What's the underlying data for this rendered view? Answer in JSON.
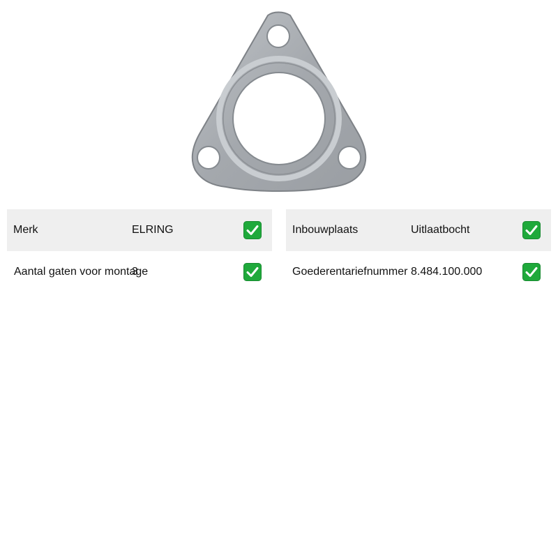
{
  "product": {
    "image_name": "exhaust-gasket-image"
  },
  "specs": {
    "left": [
      {
        "label": "Merk",
        "value": "ELRING",
        "icon": "check-icon"
      },
      {
        "label": "Aantal gaten voor montage",
        "value": "3",
        "icon": "check-icon"
      }
    ],
    "right": [
      {
        "label": "Inbouwplaats",
        "value": "Uitlaatbocht",
        "icon": "check-icon"
      },
      {
        "label": "Goederentariefnummer",
        "value": "8.484.100.000",
        "icon": "check-icon"
      }
    ]
  },
  "colors": {
    "row_shade": "#efefef",
    "check_green": "#1fa93b",
    "gasket_metal": "#a9adb1"
  }
}
